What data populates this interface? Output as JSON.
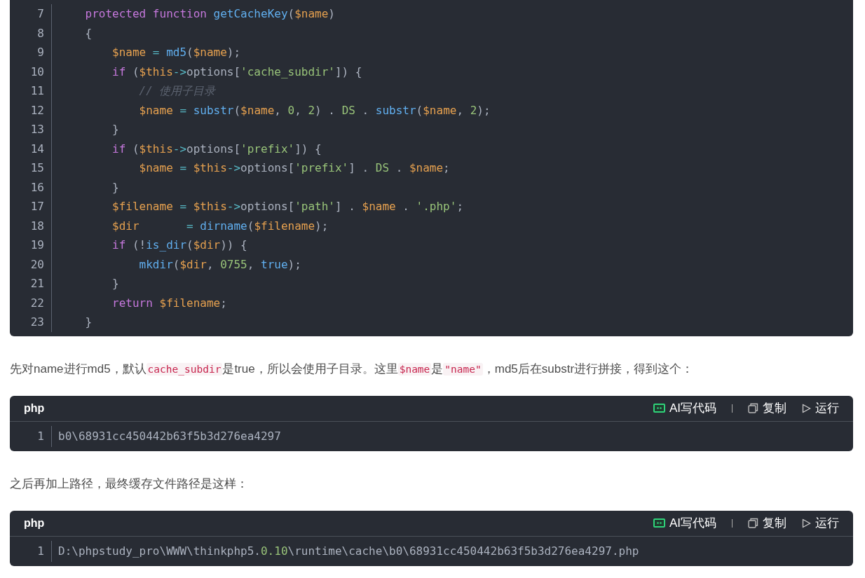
{
  "content": [
    {
      "kind": "code",
      "lines": [
        {
          "number": "7",
          "tokens": [
            {
              "kind": "kw",
              "text": "    protected"
            },
            {
              "kind": "kw",
              "text": " function"
            },
            {
              "kind": "fn",
              "text": " getCacheKey"
            },
            {
              "kind": "plain",
              "text": "("
            },
            {
              "kind": "var",
              "text": "$name"
            },
            {
              "kind": "plain",
              "text": ")"
            }
          ]
        },
        {
          "number": "8",
          "tokens": [
            {
              "kind": "plain",
              "text": "    {"
            }
          ]
        },
        {
          "number": "9",
          "tokens": [
            {
              "kind": "var",
              "text": "        $name"
            },
            {
              "kind": "op",
              "text": " = "
            },
            {
              "kind": "fn",
              "text": "md5"
            },
            {
              "kind": "plain",
              "text": "("
            },
            {
              "kind": "var",
              "text": "$name"
            },
            {
              "kind": "plain",
              "text": ");"
            }
          ]
        },
        {
          "number": "10",
          "tokens": [
            {
              "kind": "kw",
              "text": "        if"
            },
            {
              "kind": "plain",
              "text": " ("
            },
            {
              "kind": "var",
              "text": "$this"
            },
            {
              "kind": "op",
              "text": "->"
            },
            {
              "kind": "plain",
              "text": "options["
            },
            {
              "kind": "str",
              "text": "'cache_subdir'"
            },
            {
              "kind": "plain",
              "text": "]) {"
            }
          ]
        },
        {
          "number": "11",
          "tokens": [
            {
              "kind": "com",
              "text": "            // 使用子目录"
            }
          ]
        },
        {
          "number": "12",
          "tokens": [
            {
              "kind": "var",
              "text": "            $name"
            },
            {
              "kind": "op",
              "text": " = "
            },
            {
              "kind": "fn",
              "text": "substr"
            },
            {
              "kind": "plain",
              "text": "("
            },
            {
              "kind": "var",
              "text": "$name"
            },
            {
              "kind": "plain",
              "text": ", "
            },
            {
              "kind": "num",
              "text": "0"
            },
            {
              "kind": "plain",
              "text": ", "
            },
            {
              "kind": "num",
              "text": "2"
            },
            {
              "kind": "plain",
              "text": ") . "
            },
            {
              "kind": "num",
              "text": "DS"
            },
            {
              "kind": "plain",
              "text": " . "
            },
            {
              "kind": "fn",
              "text": "substr"
            },
            {
              "kind": "plain",
              "text": "("
            },
            {
              "kind": "var",
              "text": "$name"
            },
            {
              "kind": "plain",
              "text": ", "
            },
            {
              "kind": "num",
              "text": "2"
            },
            {
              "kind": "plain",
              "text": ");"
            }
          ]
        },
        {
          "number": "13",
          "tokens": [
            {
              "kind": "plain",
              "text": "        }"
            }
          ]
        },
        {
          "number": "14",
          "tokens": [
            {
              "kind": "kw",
              "text": "        if"
            },
            {
              "kind": "plain",
              "text": " ("
            },
            {
              "kind": "var",
              "text": "$this"
            },
            {
              "kind": "op",
              "text": "->"
            },
            {
              "kind": "plain",
              "text": "options["
            },
            {
              "kind": "str",
              "text": "'prefix'"
            },
            {
              "kind": "plain",
              "text": "]) {"
            }
          ]
        },
        {
          "number": "15",
          "tokens": [
            {
              "kind": "var",
              "text": "            $name"
            },
            {
              "kind": "op",
              "text": " = "
            },
            {
              "kind": "var",
              "text": "$this"
            },
            {
              "kind": "op",
              "text": "->"
            },
            {
              "kind": "plain",
              "text": "options["
            },
            {
              "kind": "str",
              "text": "'prefix'"
            },
            {
              "kind": "plain",
              "text": "] . "
            },
            {
              "kind": "num",
              "text": "DS"
            },
            {
              "kind": "plain",
              "text": " . "
            },
            {
              "kind": "var",
              "text": "$name"
            },
            {
              "kind": "plain",
              "text": ";"
            }
          ]
        },
        {
          "number": "16",
          "tokens": [
            {
              "kind": "plain",
              "text": "        }"
            }
          ]
        },
        {
          "number": "17",
          "tokens": [
            {
              "kind": "var",
              "text": "        $filename"
            },
            {
              "kind": "op",
              "text": " = "
            },
            {
              "kind": "var",
              "text": "$this"
            },
            {
              "kind": "op",
              "text": "->"
            },
            {
              "kind": "plain",
              "text": "options["
            },
            {
              "kind": "str",
              "text": "'path'"
            },
            {
              "kind": "plain",
              "text": "] . "
            },
            {
              "kind": "var",
              "text": "$name"
            },
            {
              "kind": "plain",
              "text": " . "
            },
            {
              "kind": "str",
              "text": "'.php'"
            },
            {
              "kind": "plain",
              "text": ";"
            }
          ]
        },
        {
          "number": "18",
          "tokens": [
            {
              "kind": "var",
              "text": "        $dir"
            },
            {
              "kind": "op",
              "text": "       = "
            },
            {
              "kind": "fn",
              "text": "dirname"
            },
            {
              "kind": "plain",
              "text": "("
            },
            {
              "kind": "var",
              "text": "$filename"
            },
            {
              "kind": "plain",
              "text": ");"
            }
          ]
        },
        {
          "number": "19",
          "tokens": [
            {
              "kind": "kw",
              "text": "        if"
            },
            {
              "kind": "plain",
              "text": " (!"
            },
            {
              "kind": "fn",
              "text": "is_dir"
            },
            {
              "kind": "plain",
              "text": "("
            },
            {
              "kind": "var",
              "text": "$dir"
            },
            {
              "kind": "plain",
              "text": ")) {"
            }
          ]
        },
        {
          "number": "20",
          "tokens": [
            {
              "kind": "fn",
              "text": "            mkdir"
            },
            {
              "kind": "plain",
              "text": "("
            },
            {
              "kind": "var",
              "text": "$dir"
            },
            {
              "kind": "plain",
              "text": ", "
            },
            {
              "kind": "num",
              "text": "0755"
            },
            {
              "kind": "plain",
              "text": ", "
            },
            {
              "kind": "fn",
              "text": "true"
            },
            {
              "kind": "plain",
              "text": ");"
            }
          ]
        },
        {
          "number": "21",
          "tokens": [
            {
              "kind": "plain",
              "text": "        }"
            }
          ]
        },
        {
          "number": "22",
          "tokens": [
            {
              "kind": "kw",
              "text": "        return"
            },
            {
              "kind": "var",
              "text": " $filename"
            },
            {
              "kind": "plain",
              "text": ";"
            }
          ]
        },
        {
          "number": "23",
          "tokens": [
            {
              "kind": "plain",
              "text": "    }"
            }
          ]
        }
      ]
    },
    {
      "kind": "paragraph",
      "segments": [
        {
          "kind": "text",
          "text": "先对name进行md5，默认"
        },
        {
          "kind": "code",
          "text": "cache_subdir"
        },
        {
          "kind": "text",
          "text": "是true，所以会使用子目录。这里"
        },
        {
          "kind": "code",
          "text": "$name"
        },
        {
          "kind": "text",
          "text": "是"
        },
        {
          "kind": "code",
          "text": "\"name\""
        },
        {
          "kind": "text",
          "text": "，md5后在substr进行拼接，得到这个："
        }
      ]
    },
    {
      "kind": "code",
      "header": {
        "language": "php",
        "actions": [
          {
            "kind": "ai",
            "label": "AI写代码"
          },
          {
            "kind": "copy",
            "label": "复制"
          },
          {
            "kind": "run",
            "label": "运行"
          }
        ]
      },
      "lines": [
        {
          "number": "1",
          "tokens": [
            {
              "kind": "plain",
              "text": "b0\\68931cc450442b63f5b3d276ea4297"
            }
          ]
        }
      ]
    },
    {
      "kind": "paragraph",
      "segments": [
        {
          "kind": "text",
          "text": "之后再加上路径，最终缓存文件路径是这样："
        }
      ]
    },
    {
      "kind": "code",
      "header": {
        "language": "php",
        "actions": [
          {
            "kind": "ai",
            "label": "AI写代码"
          },
          {
            "kind": "copy",
            "label": "复制"
          },
          {
            "kind": "run",
            "label": "运行"
          }
        ]
      },
      "lines": [
        {
          "number": "1",
          "tokens": [
            {
              "kind": "plain",
              "text": "D:\\phpstudy_pro\\WWW\\thinkphp5."
            },
            {
              "kind": "num",
              "text": "0.10"
            },
            {
              "kind": "plain",
              "text": "\\runtime\\cache\\b0\\68931cc450442b63f5b3d276ea4297.php"
            }
          ]
        }
      ]
    }
  ]
}
